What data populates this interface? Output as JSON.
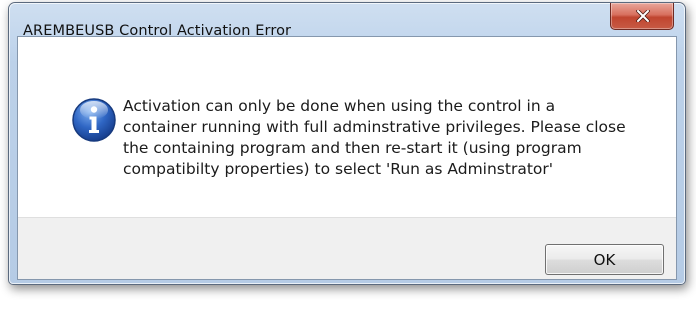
{
  "dialog": {
    "title": "AREMBEUSB Control Activation Error",
    "close_icon": "close-icon",
    "icon": "information-icon",
    "message": "Activation can only be done when using the control in a\ncontainer running with full adminstrative privileges. Please close\nthe containing program and then re-start it (using program\ncompatibilty properties) to select 'Run as Adminstrator'",
    "ok_label": "OK"
  },
  "colors": {
    "frame": "#bcd1e9",
    "close_button": "#c75b45",
    "footer": "#f0f0f0",
    "info_icon": "#2a5cb8"
  }
}
